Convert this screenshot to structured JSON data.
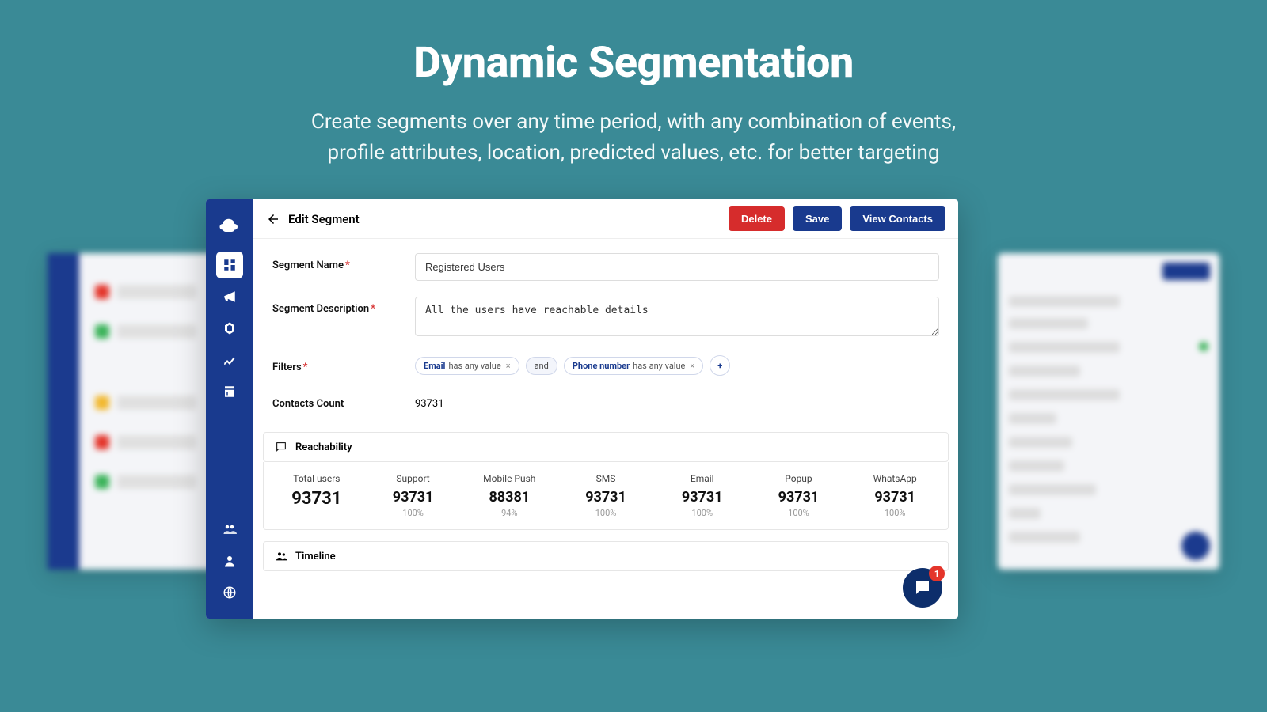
{
  "hero": {
    "title": "Dynamic Segmentation",
    "subtitle_l1": "Create segments over any time period, with any combination of events,",
    "subtitle_l2": "profile attributes, location, predicted values, etc. for better targeting"
  },
  "topbar": {
    "title": "Edit Segment",
    "delete": "Delete",
    "save": "Save",
    "view_contacts": "View Contacts"
  },
  "form": {
    "segment_name_label": "Segment Name",
    "segment_name_value": "Registered Users",
    "segment_desc_label": "Segment Description",
    "segment_desc_value": "All the users have reachable details",
    "filters_label": "Filters",
    "filter1_field": "Email",
    "filter1_op": "has any value",
    "and_label": "and",
    "filter2_field": "Phone number",
    "filter2_op": "has any value",
    "add_plus": "+",
    "count_label": "Contacts Count",
    "count_value": "93731"
  },
  "reachability": {
    "header": "Reachability",
    "total_label": "Total users",
    "total_value": "93731",
    "channels": [
      {
        "label": "Support",
        "value": "93731",
        "pct": "100%"
      },
      {
        "label": "Mobile Push",
        "value": "88381",
        "pct": "94%"
      },
      {
        "label": "SMS",
        "value": "93731",
        "pct": "100%"
      },
      {
        "label": "Email",
        "value": "93731",
        "pct": "100%"
      },
      {
        "label": "Popup",
        "value": "93731",
        "pct": "100%"
      },
      {
        "label": "WhatsApp",
        "value": "93731",
        "pct": "100%"
      }
    ]
  },
  "timeline": {
    "header": "Timeline"
  },
  "chat": {
    "badge": "1"
  }
}
